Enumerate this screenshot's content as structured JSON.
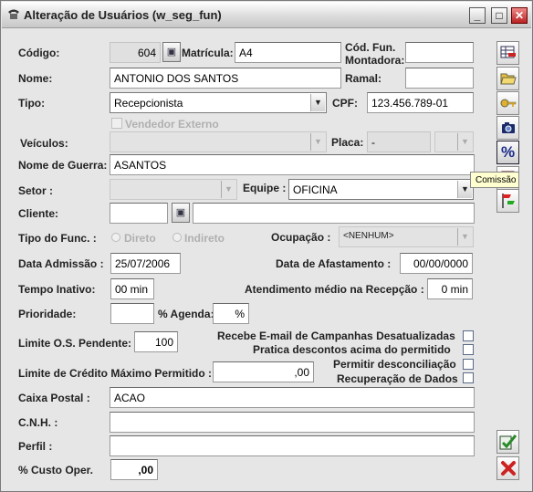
{
  "window": {
    "title": "Alteração de Usuários (w_seg_fun)"
  },
  "form": {
    "codigo_label": "Código:",
    "codigo": "604",
    "matricula_label": "Matrícula:",
    "matricula": "A4",
    "cod_fun_montadora_label_1": "Cód. Fun.",
    "cod_fun_montadora_label_2": "Montadora:",
    "cod_fun_montadora": "",
    "nome_label": "Nome:",
    "nome": "ANTONIO DOS SANTOS",
    "ramal_label": "Ramal:",
    "ramal": "",
    "tipo_label": "Tipo:",
    "tipo": "Recepcionista",
    "cpf_label": "CPF:",
    "cpf": "123.456.789-01",
    "vendedor_externo_label": "Vendedor Externo",
    "veiculos_label": "Veículos:",
    "veiculos": "",
    "placa_label": "Placa:",
    "placa": "-",
    "nome_guerra_label": "Nome de Guerra:",
    "nome_guerra": "ASANTOS",
    "setor_label": "Setor :",
    "setor": "",
    "equipe_label": "Equipe :",
    "equipe": "OFICINA",
    "cliente_label": "Cliente:",
    "cliente_codigo": "",
    "cliente_nome": "",
    "tipo_func_label": "Tipo do Func. :",
    "tipo_func_direto": "Direto",
    "tipo_func_indireto": "Indireto",
    "ocupacao_label": "Ocupação :",
    "ocupacao": "<NENHUM>",
    "data_admissao_label": "Data Admissão :",
    "data_admissao": "25/07/2006",
    "data_afastamento_label": "Data de Afastamento :",
    "data_afastamento": "00/00/0000",
    "tempo_inativo_label": "Tempo Inativo:",
    "tempo_inativo": "00 min",
    "atendimento_medio_label": "Atendimento médio na Recepção :",
    "atendimento_medio": "0 min",
    "prioridade_label": "Prioridade:",
    "prioridade": "",
    "agenda_label": "% Agenda:",
    "agenda": "%",
    "limite_os_label": "Limite O.S. Pendente:",
    "limite_os": "100",
    "recebe_email_label": "Recebe E-mail de Campanhas Desatualizadas",
    "pratica_descontos_label": "Pratica descontos acima do permitido",
    "limite_credito_label": "Limite de Crédito Máximo Permitido :",
    "limite_credito": ",00",
    "permitir_desconciliacao_label": "Permitir desconciliação",
    "recuperacao_dados_label": "Recuperação de Dados",
    "caixa_postal_label": "Caixa Postal :",
    "caixa_postal": "ACAO",
    "cnh_label": "C.N.H. :",
    "cnh": "",
    "perfil_label": "Perfil :",
    "perfil": "",
    "custo_oper_label": "% Custo Oper.",
    "custo_oper": ",00"
  },
  "toolbar": {
    "items": [
      "table-edit-icon",
      "folder-open-icon",
      "key-icon",
      "camera-icon",
      "percent-icon",
      "calculator-icon",
      "flag-icon"
    ],
    "percent_glyph": "%",
    "tooltip": "Comissão"
  },
  "actions": {
    "confirm_icon": "check-icon",
    "cancel_icon": "x-icon"
  },
  "colors": {
    "window_bg": "#e6e6e6",
    "tooltip_bg": "#ffffd0",
    "cancel_red": "#cc2222",
    "confirm_green": "#2a8a2a"
  }
}
